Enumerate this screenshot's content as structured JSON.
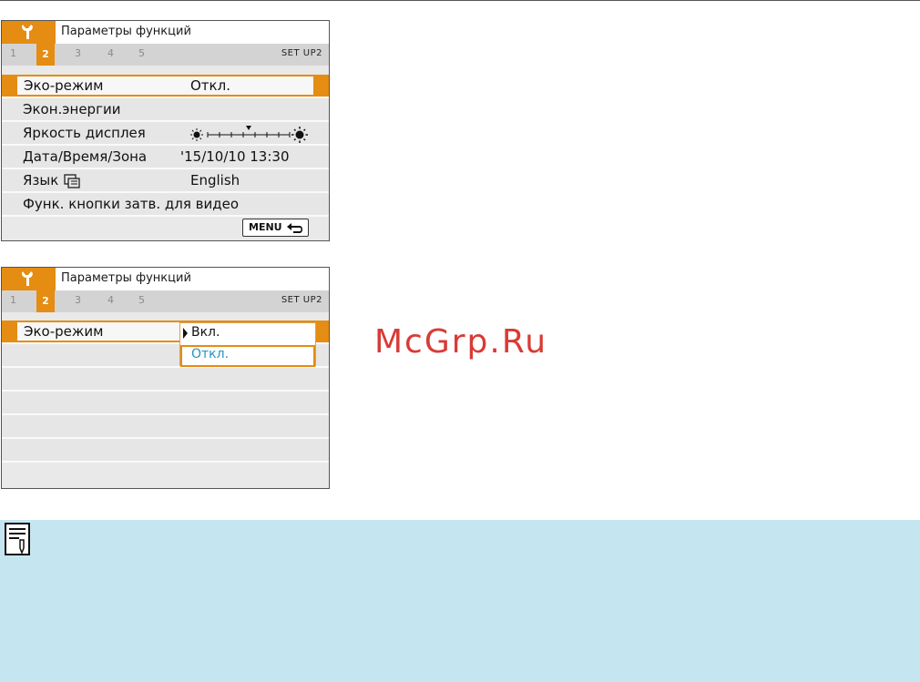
{
  "screen1": {
    "title": "Параметры функций",
    "tabs": [
      "1",
      "2",
      "3",
      "4",
      "5"
    ],
    "active_tab": "2",
    "setup_label": "SET UP2",
    "rows": [
      {
        "label": "Эко-режим",
        "value": "Откл.",
        "selected": true
      },
      {
        "label": "Экон.энергии",
        "value": ""
      },
      {
        "label": "Яркость дисплея",
        "value": ""
      },
      {
        "label": "Дата/Время/Зона",
        "value": "'15/10/10 13:30"
      },
      {
        "label": "Язык",
        "value": "English"
      },
      {
        "label": "Функ. кнопки затв. для видео",
        "value": ""
      }
    ],
    "menu_button": "MENU",
    "brightness_level_fraction": 0.5
  },
  "screen2": {
    "title": "Параметры функций",
    "tabs": [
      "1",
      "2",
      "3",
      "4",
      "5"
    ],
    "active_tab": "2",
    "setup_label": "SET UP2",
    "selected_row_label": "Эко-режим",
    "options": [
      "Вкл.",
      "Откл."
    ],
    "current_option": "Вкл.",
    "highlighted_option": "Откл."
  },
  "watermark": "McGrp.Ru",
  "colors": {
    "accent": "#e58c12",
    "note_bg": "#c5e6f0",
    "watermark": "#d83b35",
    "highlight_text": "#2a8fc7"
  },
  "icons": [
    "wrench-icon",
    "return-arrow-icon",
    "language-icon",
    "brightness-low-icon",
    "brightness-high-icon",
    "note-icon"
  ]
}
